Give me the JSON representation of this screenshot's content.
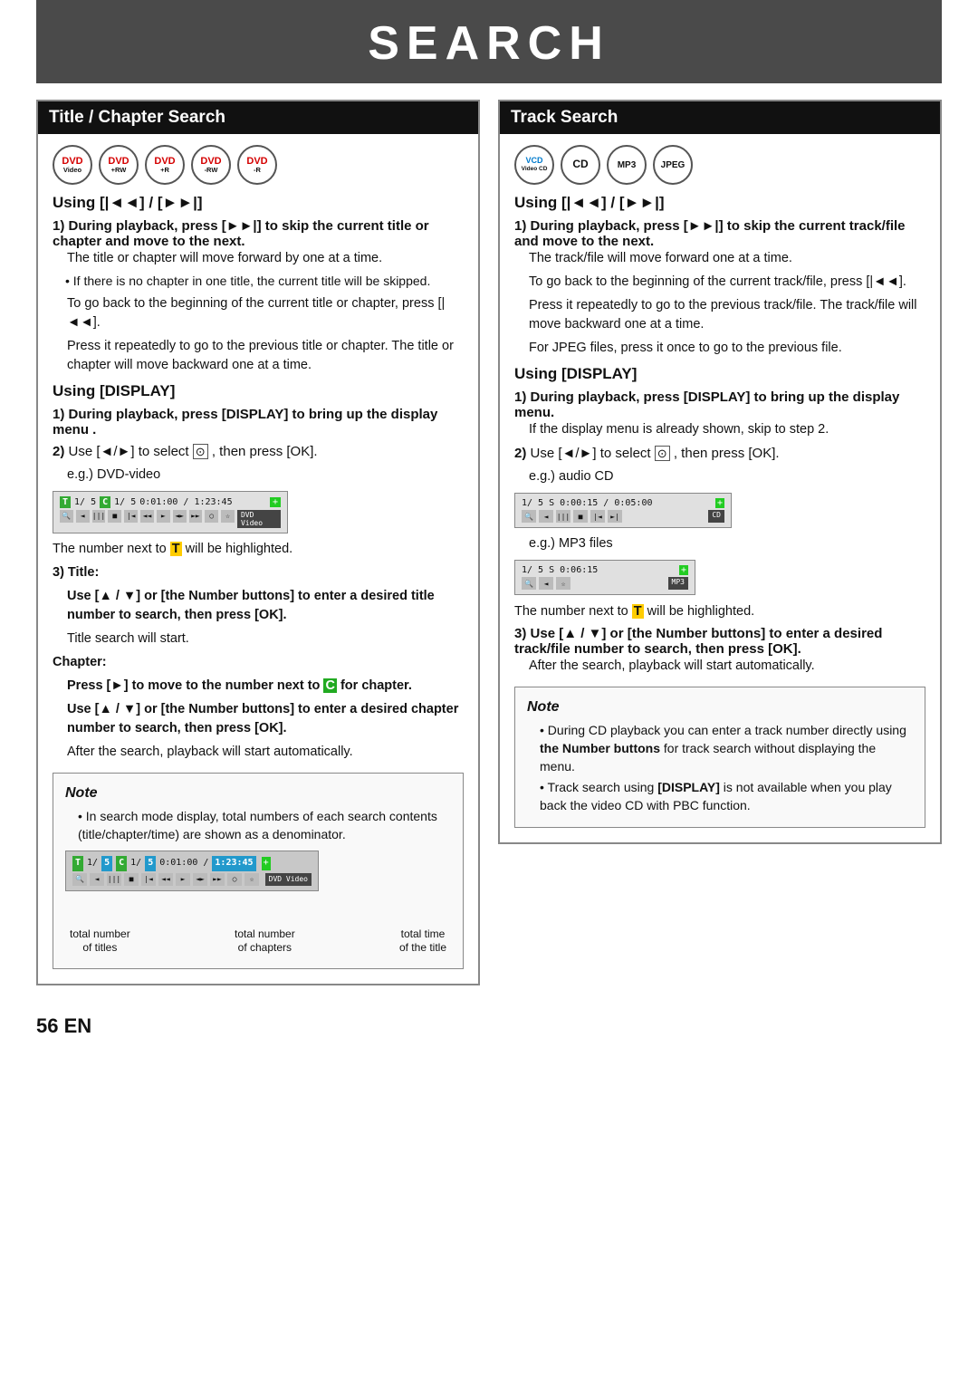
{
  "page": {
    "main_title": "SEARCH",
    "footer": "56  EN"
  },
  "left_col": {
    "header": "Title / Chapter Search",
    "discs": [
      {
        "label": "DVD",
        "sub": "Video",
        "class": "dvd-video"
      },
      {
        "label": "DVD",
        "sub": "+RW",
        "class": "dvd-rw1"
      },
      {
        "label": "DVD",
        "sub": "+R",
        "class": "dvd-plus"
      },
      {
        "label": "DVD",
        "sub": "-RW",
        "class": "dvd-rw2"
      },
      {
        "label": "DVD",
        "sub": "-R",
        "class": "dvd-r"
      }
    ],
    "using_skip_heading": "Using [|◄◄] / [►►|]",
    "step1_label": "1)",
    "step1_bold": "During playback, press [►►|] to skip the current title or chapter and move to the next.",
    "step1_p1": "The title or chapter will move forward by one at a time.",
    "step1_bullet": "If there is no chapter in one title, the current title will be skipped.",
    "step1_p2": "To go back to the beginning of the current title or chapter, press [|◄◄].",
    "step1_p3": "Press it repeatedly to go to the previous title or chapter. The title or chapter will move backward one at a time.",
    "using_display_heading": "Using [DISPLAY]",
    "step1d_label": "1)",
    "step1d_bold": "During playback, press [DISPLAY] to bring up the display menu .",
    "step2d_label": "2)",
    "step2d_text": "Use [◄/►] to select",
    "step2d_icon": "⊙",
    "step2d_text2": ", then press [OK].",
    "step2d_eg": "e.g.) DVD-video",
    "screen_dvd": {
      "row1": "T  1/ 5  C  1/ 5  0:01:00 / 1:23:45",
      "icons": "Q ◄ ||| |■ |◄◄ |||►| ►► ○ ☆",
      "badge": "DVD Video"
    },
    "highlighted_text": "The number next to",
    "T_highlight": "T",
    "highlighted_text2": "will be highlighted.",
    "step3_label": "3) Title:",
    "step3_use": "Use [▲ / ▼] or [the Number buttons] to enter a desired title number to search, then press [OK].",
    "step3_note": "Title search will start.",
    "chapter_label": "Chapter:",
    "chapter_press": "Press [►] to move to the number next to",
    "chapter_C": "C",
    "chapter_press2": "for chapter.",
    "chapter_use": "Use [▲ / ▼] or [the Number buttons] to enter a desired chapter number to search, then press [OK].",
    "chapter_after": "After the search, playback will start automatically.",
    "note_title": "Note",
    "note_bullet": "In search mode display, total numbers of each search contents (title/chapter/time) are shown as a denominator.",
    "note_screen": {
      "row1": "T  1/ 5  C  1/ 5  0:01:00 / 1:23:45",
      "icons": "Q ◄ ||| |■ |◄◄ |||►| ►► ○ ☆",
      "badge": "DVD Video"
    },
    "diagram_label1": "total number\nof titles",
    "diagram_label2": "total number\nof chapters",
    "diagram_label3": "total time\nof the title"
  },
  "right_col": {
    "header": "Track Search",
    "discs": [
      {
        "label": "VCD",
        "sub": "Video CD",
        "class": "vcd"
      },
      {
        "label": "CD",
        "sub": "",
        "class": "cd"
      },
      {
        "label": "MP3",
        "sub": "",
        "class": "mp3"
      },
      {
        "label": "JPEG",
        "sub": "",
        "class": "jpeg"
      }
    ],
    "using_skip_heading": "Using [|◄◄] / [►►|]",
    "step1_label": "1)",
    "step1_bold": "During playback, press [►►|] to skip the current track/file and move to the next.",
    "step1_p1": "The track/file will move forward one at a time.",
    "step1_p2": "To go back to the beginning of the current track/file, press [|◄◄].",
    "step1_p3": "Press it repeatedly to go to the previous track/file. The track/file will move backward one at a time.",
    "step1_p4": "For JPEG files, press it once to go to the previous file.",
    "using_display_heading": "Using [DISPLAY]",
    "step1d_label": "1)",
    "step1d_bold": "During playback, press [DISPLAY] to bring up the display menu.",
    "step1d_p": "If the display menu is already shown, skip to step 2.",
    "step2d_label": "2)",
    "step2d_text": "Use [◄/►] to select",
    "step2d_icon": "⊙",
    "step2d_text2": ", then press [OK].",
    "step2d_eg_cd": "e.g.) audio CD",
    "screen_cd": {
      "row1": "1/ 5  S  0:00:15 / 0:05:00",
      "icons": "Q ◄ ||| |■ |◄◄ ►|",
      "badge": "CD"
    },
    "step2d_eg_mp3": "e.g.) MP3 files",
    "screen_mp3": {
      "row1": "1/ 5  S  0:06:15",
      "icons": "Q ◄ ☆|",
      "badge": "MP3"
    },
    "highlighted_text": "The number next to",
    "T_highlight": "T",
    "highlighted_text2": "will be highlighted.",
    "step3_label": "3)",
    "step3_use": "Use [▲ / ▼] or [the Number buttons] to enter a desired track/file number to search, then press [OK].",
    "step3_after": "After the search, playback will start automatically.",
    "note_title": "Note",
    "note_bullet1": "During CD playback you can enter a track number directly using",
    "note_bullet1_bold": "the Number buttons",
    "note_bullet1_end": "for track search without displaying the menu.",
    "note_bullet2_start": "Track search using",
    "note_bullet2_bold": "[DISPLAY]",
    "note_bullet2_end": "is not available when you play back the video CD with PBC function."
  }
}
